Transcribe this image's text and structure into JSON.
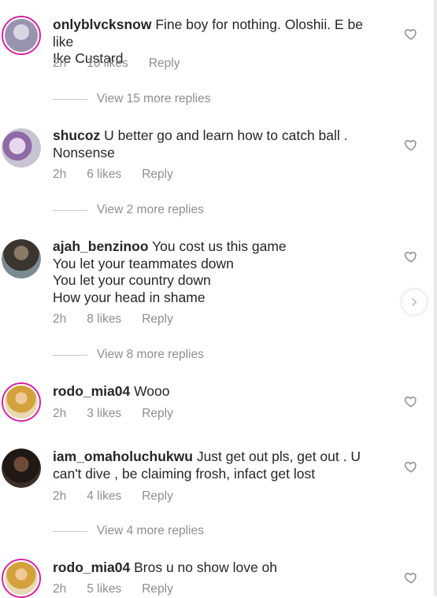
{
  "comments": [
    {
      "user": "onlyblvcksnow",
      "text": " Fine boy for nothing. Oloshii. E be like\nIke Custard",
      "time": "2h",
      "likes": "10 likes",
      "reply": "Reply",
      "view_replies": "View 15 more replies",
      "avatar_color": "#9a93b0"
    },
    {
      "user": "shucoz",
      "text": " U better go and learn how to catch ball .\nNonsense",
      "time": "2h",
      "likes": "6 likes",
      "reply": "Reply",
      "view_replies": "View 2 more replies",
      "avatar_color": "#a8a3b8"
    },
    {
      "user": "ajah_benzinoo",
      "text": " You cost us this game\nYou let your teammates down\nYou let your country down\nHow your head in shame",
      "time": "2h",
      "likes": "8 likes",
      "reply": "Reply",
      "view_replies": "View 8 more replies",
      "avatar_color": "#5b5448"
    },
    {
      "user": "rodo_mia04",
      "text": " Wooo",
      "time": "2h",
      "likes": "3 likes",
      "reply": "Reply",
      "view_replies": "",
      "avatar_color": "#c9a34a"
    },
    {
      "user": "iam_omaholuchukwu",
      "text": " Just get out pls, get out . U\ncan't dive , be claiming frosh, infact get lost",
      "time": "2h",
      "likes": "4 likes",
      "reply": "Reply",
      "view_replies": "View 4 more replies",
      "avatar_color": "#3b2a22"
    },
    {
      "user": "rodo_mia04",
      "text": " Bros u no show love oh",
      "time": "2h",
      "likes": "5 likes",
      "reply": "Reply",
      "view_replies": "",
      "avatar_color": "#c9a34a"
    }
  ],
  "icons": {
    "like": "heart-icon",
    "next": "chevron-right-icon"
  },
  "colors": {
    "ring": "#d6249f",
    "muted": "#8e8e8e",
    "text": "#262626"
  }
}
